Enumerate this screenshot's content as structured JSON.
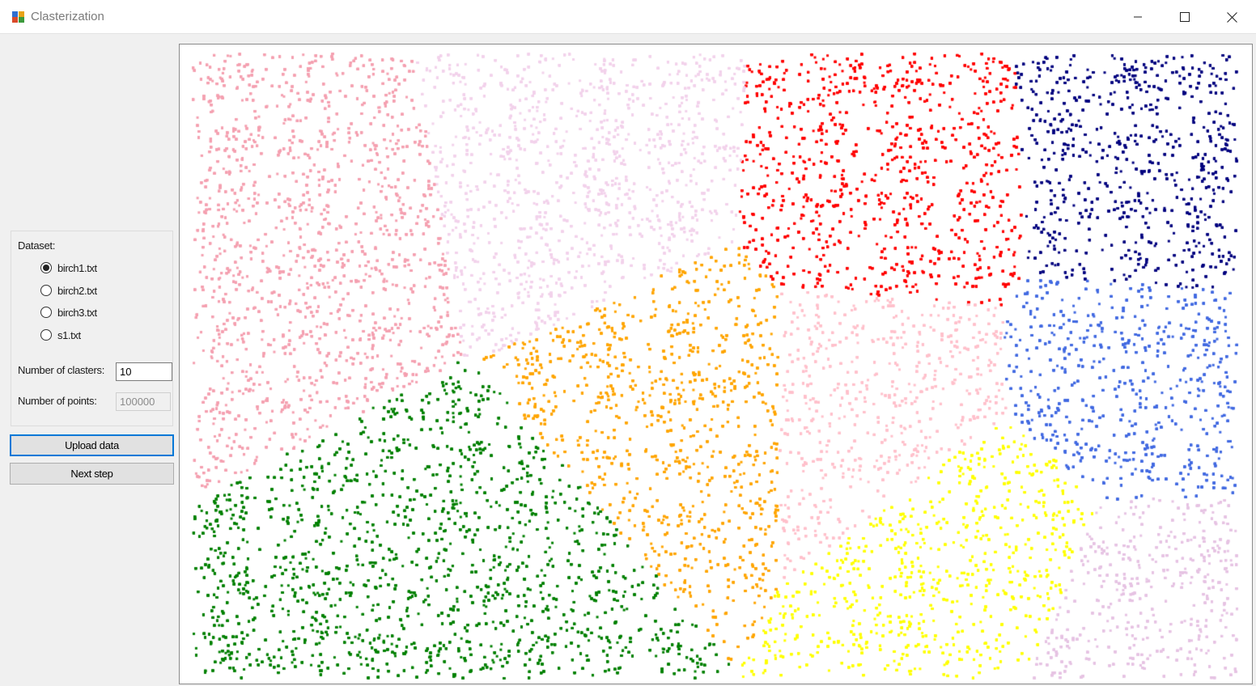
{
  "window": {
    "title": "Clasterization",
    "icon": "app-icon",
    "controls": [
      "minimize-icon",
      "maximize-icon",
      "close-icon"
    ]
  },
  "dataset": {
    "label": "Dataset:",
    "options": [
      {
        "label": "birch1.txt",
        "selected": true
      },
      {
        "label": "birch2.txt",
        "selected": false
      },
      {
        "label": "birch3.txt",
        "selected": false
      },
      {
        "label": "s1.txt",
        "selected": false
      }
    ]
  },
  "clusters": {
    "label": "Number of clasters:",
    "value": "10"
  },
  "points": {
    "label": "Number of points:",
    "value": "100000"
  },
  "buttons": {
    "upload": "Upload data",
    "next": "Next step"
  },
  "chart_data": {
    "type": "scatter",
    "title": "",
    "xlabel": "",
    "ylabel": "",
    "grid": false,
    "legend": "none",
    "total_points": 100000,
    "cluster_count": 10,
    "clusters": [
      {
        "color": "#f4a0b0"
      },
      {
        "color": "#f2d2eb"
      },
      {
        "color": "#ff0000"
      },
      {
        "color": "#00007f"
      },
      {
        "color": "#ffa500"
      },
      {
        "color": "#ffc0cb"
      },
      {
        "color": "#4169e1"
      },
      {
        "color": "#008000"
      },
      {
        "color": "#ffff00"
      },
      {
        "color": "#e6c3e3"
      }
    ]
  }
}
